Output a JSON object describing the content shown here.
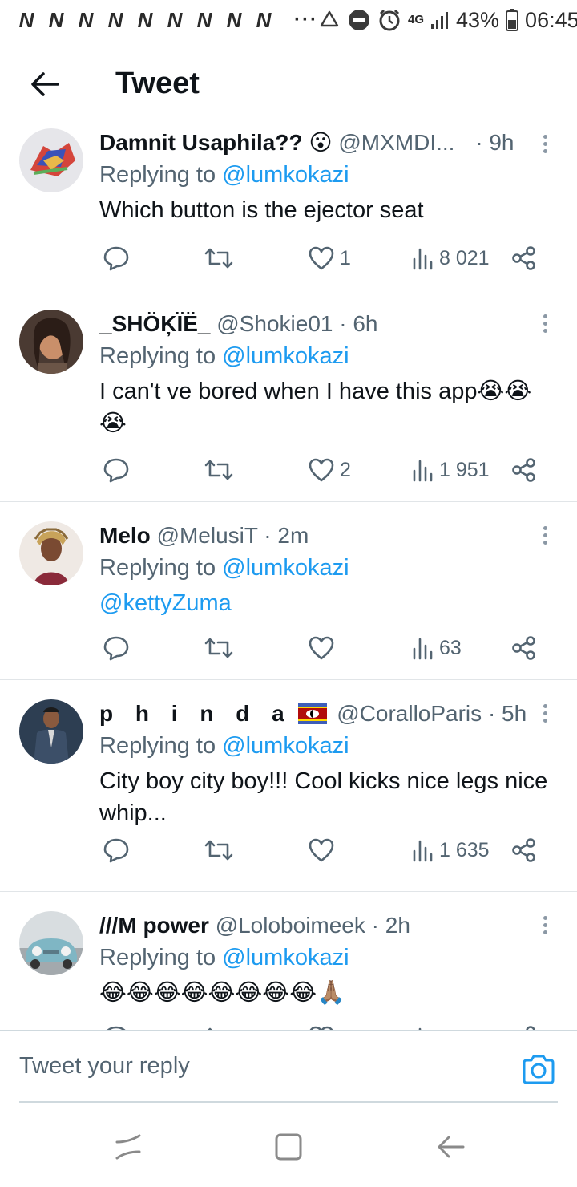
{
  "status_bar": {
    "notification_icons": [
      "N",
      "N",
      "N",
      "N",
      "N",
      "N",
      "N",
      "N",
      "N"
    ],
    "overflow_dots": "···",
    "network": "4G",
    "battery": "43%",
    "time": "06:45"
  },
  "header": {
    "title": "Tweet"
  },
  "tweets": [
    {
      "name": "Damnit Usaphila?? 😮",
      "handle": "@MXMDI...",
      "time": "· 9h",
      "replying_prefix": "Replying to ",
      "replying_to": "@lumkokazi",
      "text": "Which button is the ejector seat",
      "likes": "1",
      "views": "8 021"
    },
    {
      "name": "_SHÖĶÏË_",
      "handle": "@Shokie01",
      "time": "· 6h",
      "replying_prefix": "Replying to ",
      "replying_to": "@lumkokazi",
      "text": "I can't ve bored when I have this app😭😭",
      "text_line2": "😭",
      "likes": "2",
      "views": "1 951"
    },
    {
      "name": "Melo",
      "handle": "@MelusiT",
      "time": "· 2m",
      "replying_prefix": "Replying to ",
      "replying_to": "@lumkokazi",
      "text": "@kettyZuma",
      "likes": "",
      "views": "63"
    },
    {
      "name": "p h i n d a",
      "handle": "@CoralloParis",
      "time": "· 5h",
      "replying_prefix": "Replying to ",
      "replying_to": "@lumkokazi",
      "text": "City boy city boy!!! Cool kicks nice legs nice",
      "text_line2": "whip...",
      "likes": "",
      "views": "1 635"
    },
    {
      "name": "///M power",
      "handle": "@Loloboimeek",
      "time": "· 2h",
      "replying_prefix": "Replying to ",
      "replying_to": "@lumkokazi",
      "text": "😂😂😂😂😂😂😂😂🙏🏽"
    }
  ],
  "composer": {
    "placeholder": "Tweet your reply"
  },
  "colors": {
    "accent": "#1d9bf0",
    "text_primary": "#0f1419",
    "text_secondary": "#536471",
    "divider": "#e1e5e8"
  },
  "icons": [
    "back-arrow-icon",
    "more-vertical-icon",
    "reply-icon",
    "retweet-icon",
    "like-icon",
    "views-icon",
    "share-icon",
    "camera-icon",
    "recents-icon",
    "home-icon",
    "back-icon"
  ]
}
